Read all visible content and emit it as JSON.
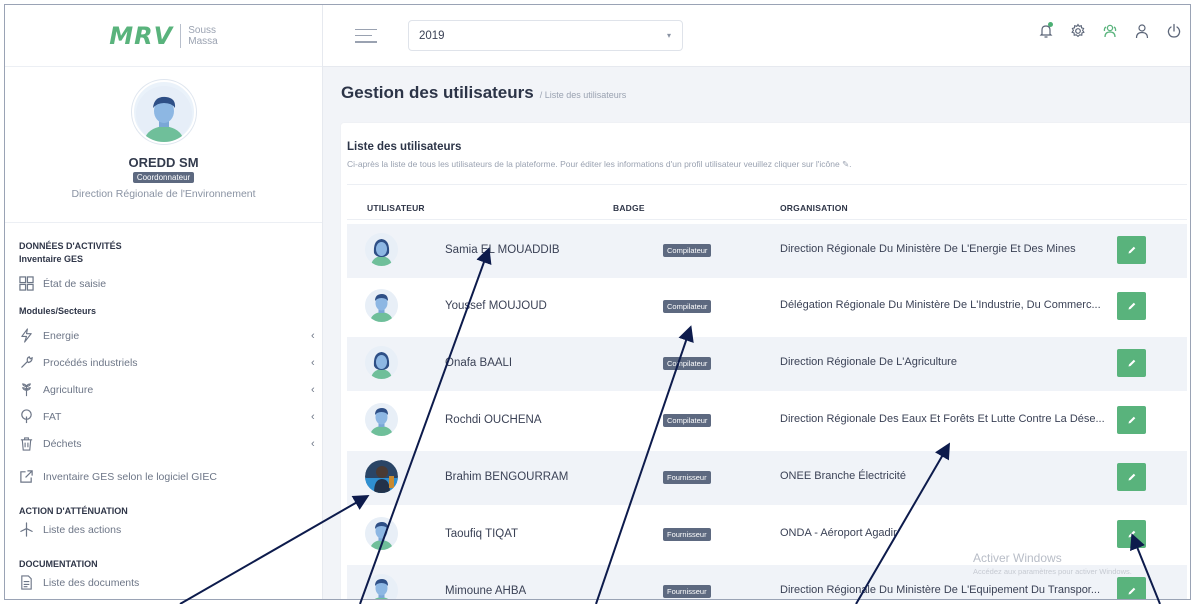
{
  "brand": {
    "logo": "MRV",
    "sub_line1": "Souss",
    "sub_line2": "Massa"
  },
  "profile": {
    "name": "OREDD SM",
    "role": "Coordonnateur",
    "organization": "Direction Régionale de l'Environnement"
  },
  "nav": {
    "section_activities": "DONNÉES D'ACTIVITÉS",
    "sub_inventory": "Inventaire GES",
    "item_etat": "État de saisie",
    "sub_modules": "Modules/Secteurs",
    "item_energie": "Energie",
    "item_procedes": "Procédés industriels",
    "item_agriculture": "Agriculture",
    "item_fat": "FAT",
    "item_dechets": "Déchets",
    "item_giec": "Inventaire GES selon le logiciel GIEC",
    "section_attenuation": "ACTION D'ATTÉNUATION",
    "item_actions": "Liste des actions",
    "section_documentation": "DOCUMENTATION",
    "item_documents": "Liste des documents",
    "caret": "‹"
  },
  "topbar": {
    "year": "2019",
    "dropdown_arrow": "▾"
  },
  "page": {
    "title": "Gestion des utilisateurs",
    "breadcrumb": "/ Liste des utilisateurs"
  },
  "card": {
    "title": "Liste des utilisateurs",
    "description": "Ci-après la liste de tous les utilisateurs de la plateforme. Pour éditer les informations d'un profil utilisateur veuillez cliquer sur l'icône ✎.",
    "col_user": "UTILISATEUR",
    "col_badge": "BADGE",
    "col_org": "ORGANISATION"
  },
  "users": [
    {
      "name": "Samia EL MOUADDIB",
      "badge": "Compilateur",
      "organization": "Direction Régionale Du Ministère De L'Energie Et Des Mines",
      "avatar": "female"
    },
    {
      "name": "Youssef MOUJOUD",
      "badge": "Compilateur",
      "organization": "Délégation Régionale Du Ministère De L'Industrie, Du Commerc...",
      "avatar": "male"
    },
    {
      "name": "Onafa BAALI",
      "badge": "Compilateur",
      "organization": "Direction Régionale De L'Agriculture",
      "avatar": "female"
    },
    {
      "name": "Rochdi OUCHENA",
      "badge": "Compilateur",
      "organization": "Direction Régionale Des Eaux Et Forêts Et Lutte Contre La Dése...",
      "avatar": "male"
    },
    {
      "name": "Brahim BENGOURRAM",
      "badge": "Fournisseur",
      "organization": "ONEE Branche Électricité",
      "avatar": "photo"
    },
    {
      "name": "Taoufiq TIQAT",
      "badge": "Fournisseur",
      "organization": "ONDA - Aéroport Agadir",
      "avatar": "male"
    },
    {
      "name": "Mimoune AHBA",
      "badge": "Fournisseur",
      "organization": "Direction Régionale Du Ministère De L'Equipement Du Transpor...",
      "avatar": "male"
    }
  ],
  "watermark": {
    "title": "Activer Windows",
    "subtitle": "Accédez aux paramètres pour activer Windows."
  },
  "colors": {
    "accent": "#59b37c",
    "badge": "#5d6980",
    "row_shade": "#f0f3f8",
    "arrow": "#0d1b4c"
  }
}
